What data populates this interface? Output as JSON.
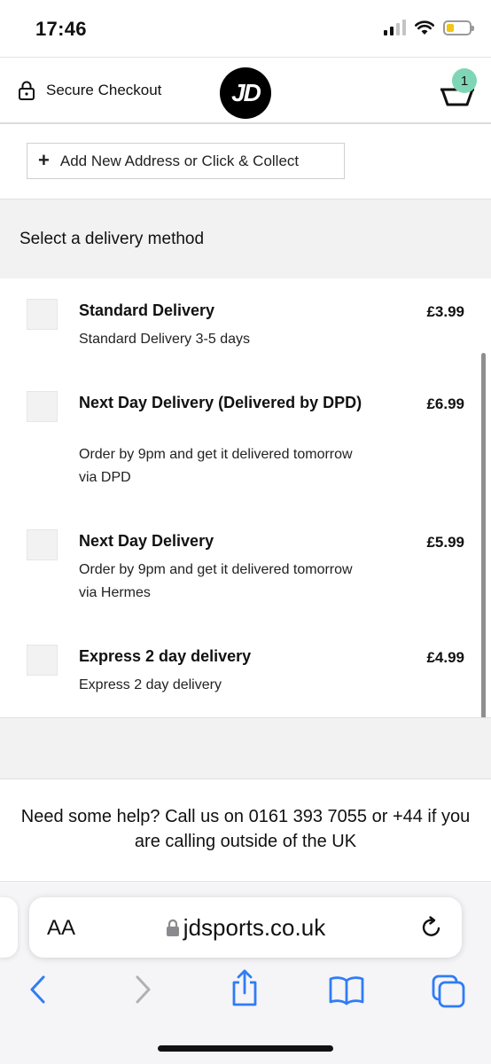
{
  "status_bar": {
    "time": "17:46"
  },
  "header": {
    "secure_label": "Secure Checkout",
    "logo_text": "JD",
    "cart_count": "1"
  },
  "address": {
    "add_button_label": "Add New Address or Click & Collect"
  },
  "delivery": {
    "heading": "Select a delivery method",
    "methods": [
      {
        "title": "Standard Delivery",
        "description": "Standard Delivery 3-5 days",
        "price": "£3.99"
      },
      {
        "title": "Next Day Delivery (Delivered by DPD)",
        "description": "Order by 9pm and get it delivered tomorrow via DPD",
        "price": "£6.99"
      },
      {
        "title": "Next Day Delivery",
        "description": "Order by 9pm and get it delivered tomorrow via Hermes",
        "price": "£5.99"
      },
      {
        "title": "Express 2 day delivery",
        "description": "Express 2 day delivery",
        "price": "£4.99"
      }
    ]
  },
  "help": {
    "text": "Need some help? Call us on 0161 393 7055 or +44 if you are calling outside of the UK"
  },
  "browser": {
    "aa_label": "AA",
    "url": "jdsports.co.uk",
    "accent_color": "#2f7cf6"
  }
}
